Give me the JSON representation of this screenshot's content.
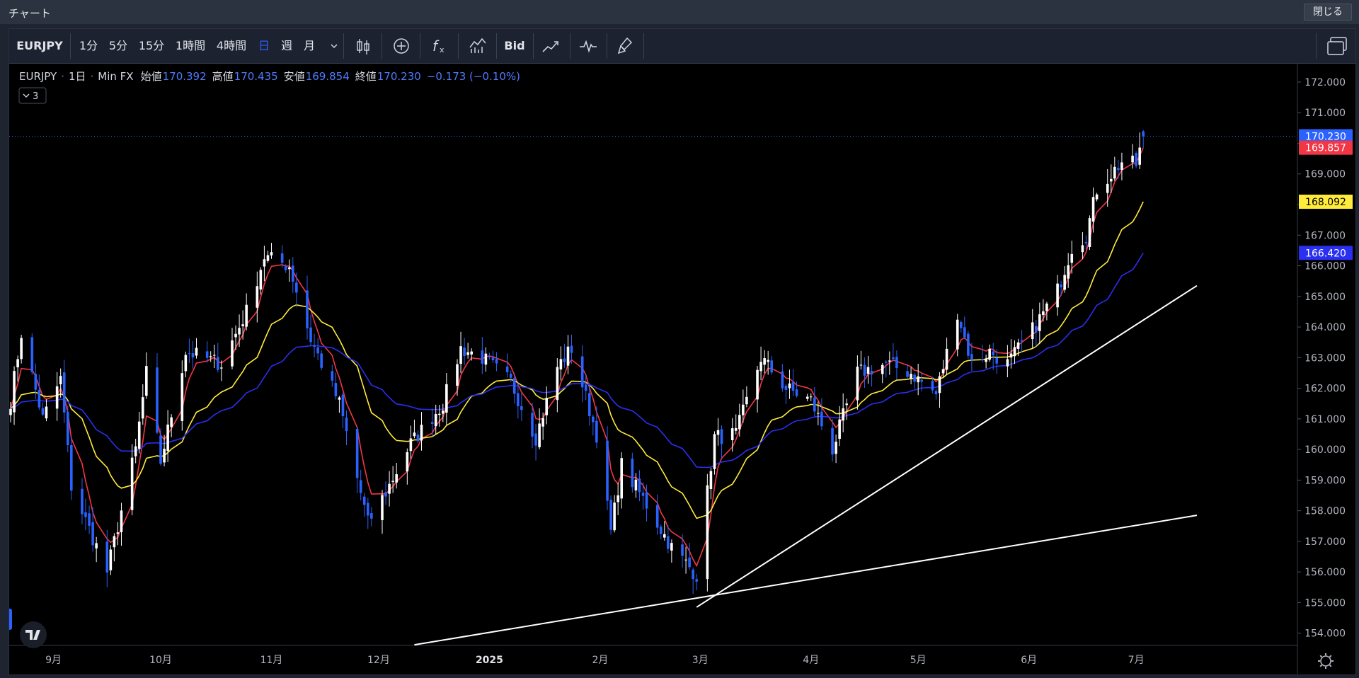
{
  "window": {
    "title": "チャート",
    "close_label": "閉じる"
  },
  "toolbar": {
    "symbol": "EURJPY",
    "intervals": [
      "1分",
      "5分",
      "15分",
      "1時間",
      "4時間",
      "日",
      "週",
      "月"
    ],
    "active_interval": "日",
    "bid_label": "Bid",
    "icons": [
      "candles-icon",
      "add-compare-icon",
      "indicators-icon",
      "chart-style-icon",
      "trend-icon",
      "replay-icon",
      "brush-icon",
      "layout-icon"
    ]
  },
  "legend": {
    "symbol": "EURJPY",
    "interval": "1日",
    "source": "Min FX",
    "open_label": "始値",
    "open": "170.392",
    "high_label": "高値",
    "high": "170.435",
    "low_label": "安値",
    "low": "169.854",
    "close_label": "終値",
    "close": "170.230",
    "change": "−0.173 (−0.10%)",
    "collapse_count": "3"
  },
  "colors": {
    "bull": "#ffffff",
    "bear": "#2962ff",
    "ma_short": "#f23645",
    "ma_mid": "#ffeb3b",
    "ma_long": "#2a2ff0",
    "trendline": "#ffffff",
    "price_line": "#2962ff"
  },
  "chart_data": {
    "type": "candlestick",
    "title": "",
    "ylim": [
      153.6,
      172.6
    ],
    "y_ticks": [
      154,
      155,
      156,
      157,
      158,
      159,
      160,
      161,
      162,
      163,
      164,
      165,
      166,
      167,
      168,
      169,
      170,
      171,
      172
    ],
    "x_ticks": [
      "9月",
      "10月",
      "11月",
      "12月",
      "2025",
      "2月",
      "3月",
      "4月",
      "5月",
      "6月",
      "7月"
    ],
    "x_ticks_bold": [
      "2025"
    ],
    "anchors": [
      {
        "date": "2024-08-20",
        "price": 161.6
      },
      {
        "date": "2024-08-23",
        "price": 163.8
      },
      {
        "date": "2024-08-29",
        "price": 161.0
      },
      {
        "date": "2024-09-03",
        "price": 162.3
      },
      {
        "date": "2024-09-06",
        "price": 158.8
      },
      {
        "date": "2024-09-16",
        "price": 156.0
      },
      {
        "date": "2024-09-24",
        "price": 160.0
      },
      {
        "date": "2024-09-27",
        "price": 162.5
      },
      {
        "date": "2024-10-01",
        "price": 159.6
      },
      {
        "date": "2024-10-08",
        "price": 163.2
      },
      {
        "date": "2024-10-18",
        "price": 162.8
      },
      {
        "date": "2024-10-25",
        "price": 164.5
      },
      {
        "date": "2024-10-30",
        "price": 166.3
      },
      {
        "date": "2024-11-06",
        "price": 166.0
      },
      {
        "date": "2024-11-12",
        "price": 163.6
      },
      {
        "date": "2024-11-20",
        "price": 161.5
      },
      {
        "date": "2024-11-28",
        "price": 157.6
      },
      {
        "date": "2024-12-03",
        "price": 158.6
      },
      {
        "date": "2024-12-10",
        "price": 160.2
      },
      {
        "date": "2024-12-19",
        "price": 161.5
      },
      {
        "date": "2024-12-24",
        "price": 163.3
      },
      {
        "date": "2024-12-30",
        "price": 163.0
      },
      {
        "date": "2025-01-07",
        "price": 162.2
      },
      {
        "date": "2025-01-14",
        "price": 160.4
      },
      {
        "date": "2025-01-20",
        "price": 162.7
      },
      {
        "date": "2025-01-24",
        "price": 163.3
      },
      {
        "date": "2025-01-31",
        "price": 160.5
      },
      {
        "date": "2025-02-04",
        "price": 157.3
      },
      {
        "date": "2025-02-07",
        "price": 159.5
      },
      {
        "date": "2025-02-14",
        "price": 158.2
      },
      {
        "date": "2025-02-21",
        "price": 156.8
      },
      {
        "date": "2025-02-28",
        "price": 155.9
      },
      {
        "date": "2025-03-05",
        "price": 160.4
      },
      {
        "date": "2025-03-11",
        "price": 160.5
      },
      {
        "date": "2025-03-18",
        "price": 163.0
      },
      {
        "date": "2025-03-25",
        "price": 162.0
      },
      {
        "date": "2025-04-01",
        "price": 161.6
      },
      {
        "date": "2025-04-07",
        "price": 160.0
      },
      {
        "date": "2025-04-14",
        "price": 162.5
      },
      {
        "date": "2025-04-22",
        "price": 162.8
      },
      {
        "date": "2025-04-29",
        "price": 162.5
      },
      {
        "date": "2025-05-06",
        "price": 161.8
      },
      {
        "date": "2025-05-12",
        "price": 164.5
      },
      {
        "date": "2025-05-16",
        "price": 162.8
      },
      {
        "date": "2025-05-21",
        "price": 163.2
      },
      {
        "date": "2025-05-26",
        "price": 162.8
      },
      {
        "date": "2025-06-02",
        "price": 163.9
      },
      {
        "date": "2025-06-09",
        "price": 165.2
      },
      {
        "date": "2025-06-13",
        "price": 166.6
      },
      {
        "date": "2025-06-17",
        "price": 167.0
      },
      {
        "date": "2025-06-20",
        "price": 168.5
      },
      {
        "date": "2025-06-24",
        "price": 169.0
      },
      {
        "date": "2025-06-27",
        "price": 169.4
      },
      {
        "date": "2025-07-01",
        "price": 169.3
      },
      {
        "date": "2025-07-03",
        "price": 170.23
      }
    ],
    "ma_last_values": {
      "short": 169.857,
      "mid": 168.092,
      "long": 166.42
    },
    "trendlines": [
      {
        "from": {
          "date": "2025-02-28",
          "price": 154.85
        },
        "to": {
          "date": "2025-07-18",
          "price": 165.35
        }
      },
      {
        "from": {
          "date": "2024-12-11",
          "price": 153.62
        },
        "to": {
          "date": "2025-07-18",
          "price": 157.85
        }
      }
    ],
    "price_labels": [
      {
        "value": "170.230",
        "bg": "#2962ff",
        "fg": "#ffffff"
      },
      {
        "value": "169.857",
        "bg": "#f23645",
        "fg": "#ffffff"
      },
      {
        "value": "168.092",
        "bg": "#ffeb3b",
        "fg": "#000000"
      },
      {
        "value": "166.420",
        "bg": "#2a2ff0",
        "fg": "#ffffff"
      }
    ]
  }
}
